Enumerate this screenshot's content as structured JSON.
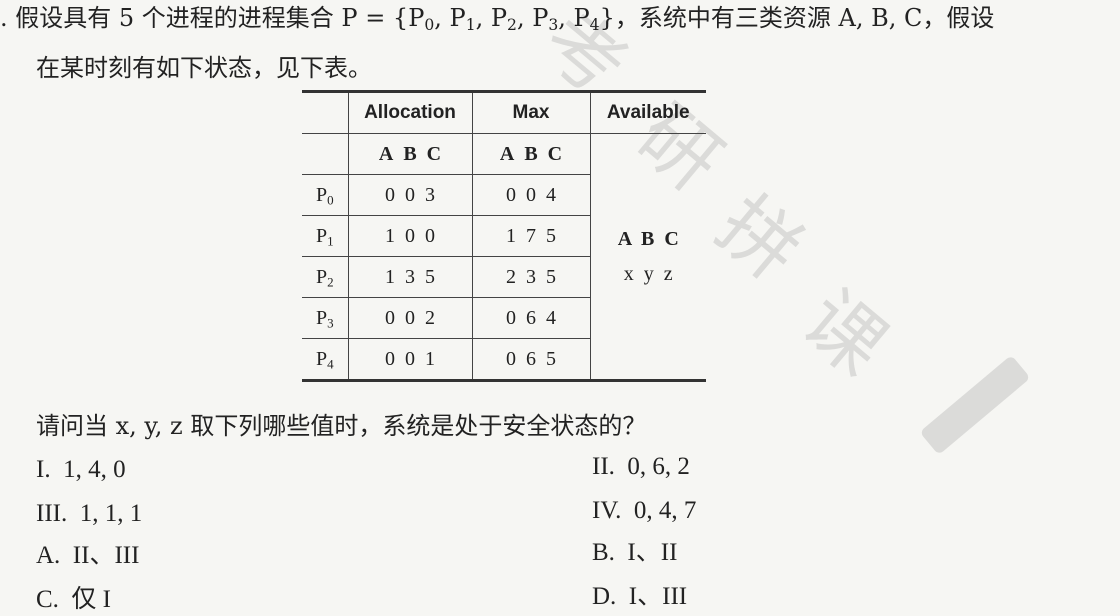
{
  "question": {
    "line1_a": ". 假设具有 5 个进程的进程集合 P = {P",
    "line1_b": "0",
    "line1_c": ", P",
    "line1_d": "1",
    "line1_e": ", P",
    "line1_f": "2",
    "line1_g": ", P",
    "line1_h": "3",
    "line1_i": ", P",
    "line1_j": "4",
    "line1_k": "}，系统中有三类资源 A, B, C，假设",
    "line2": "在某时刻有如下状态，见下表。",
    "prompt": "请问当 x, y, z 取下列哪些值时，系统是处于安全状态的？"
  },
  "table": {
    "headers": [
      "Allocation",
      "Max",
      "Available"
    ],
    "subheaders": [
      "A",
      "B",
      "C"
    ],
    "rows": [
      {
        "p": "P",
        "i": "0",
        "alloc": "0  0  3",
        "max": "0  0  4"
      },
      {
        "p": "P",
        "i": "1",
        "alloc": "1  0  0",
        "max": "1  7  5"
      },
      {
        "p": "P",
        "i": "2",
        "alloc": "1  3  5",
        "max": "2  3  5"
      },
      {
        "p": "P",
        "i": "3",
        "alloc": "0  0  2",
        "max": "0  6  4"
      },
      {
        "p": "P",
        "i": "4",
        "alloc": "0  0  1",
        "max": "0  6  5"
      }
    ],
    "available_abc": "A  B  C",
    "available_xyz": "x  y  z"
  },
  "options": [
    "I.  1, 4, 0",
    "II.  0, 6, 2",
    "III.  1, 1, 1",
    "IV.  0, 4, 7",
    "A.  II、III",
    "B.  I、II",
    "C.  仅 I",
    "D.  I、III"
  ],
  "watermark": [
    "考",
    "研",
    "拼",
    "课"
  ]
}
